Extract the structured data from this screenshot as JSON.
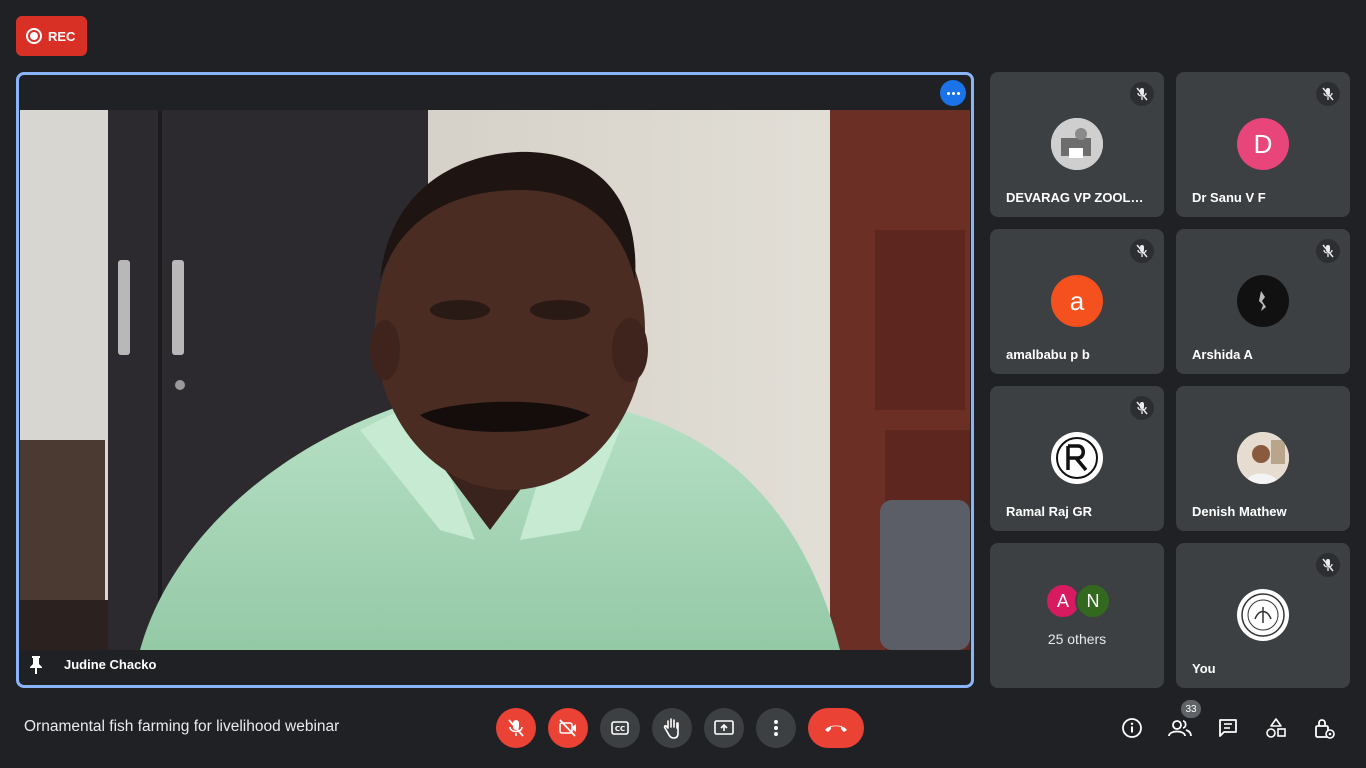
{
  "recording": {
    "label": "REC"
  },
  "main_speaker": {
    "name": "Judine Chacko"
  },
  "participants": [
    {
      "name": "DEVARAG VP ZOOLOGY",
      "avatar_type": "photo"
    },
    {
      "name": "Dr Sanu V F",
      "initial": "D",
      "color": "#e8457a"
    },
    {
      "name": "amalbabu p b",
      "initial": "a",
      "color": "#f4511e"
    },
    {
      "name": "Arshida A",
      "avatar_type": "photo"
    },
    {
      "name": "Ramal Raj GR",
      "avatar_type": "logo"
    },
    {
      "name": "Denish Mathew",
      "avatar_type": "photo"
    }
  ],
  "others": {
    "label": "25 others",
    "initials": [
      "A",
      "N"
    ],
    "colors": [
      "#d81b60",
      "#33691e"
    ]
  },
  "self_tile": {
    "name": "You"
  },
  "meeting": {
    "title": "Ornamental fish farming for livelihood webinar"
  },
  "toolbar": {
    "mic": "mic-off-icon",
    "camera": "camera-off-icon",
    "captions": "captions-icon",
    "hand": "raise-hand-icon",
    "present": "present-screen-icon",
    "more": "more-options-icon",
    "end_call": "end-call-icon"
  },
  "people_count": "33",
  "colors": {
    "accent": "#8ab4f8",
    "danger": "#ea4335",
    "tile": "#3c4043",
    "background": "#202124"
  }
}
